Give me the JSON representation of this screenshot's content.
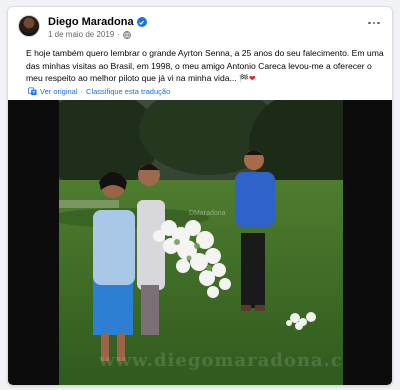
{
  "post": {
    "author": "Diego Maradona",
    "date": "1 de maio de 2019",
    "date_separator": "·",
    "text": "E hoje também quero lembrar o grande Ayrton Senna, a 25 anos do seu falecimento. Em uma das minhas visitas ao Brasil, em 1998, o meu amigo Antonio Careca levou-me a oferecer o meu respeito ao melhor piloto que já vi na minha vida...",
    "emoji_flag": "🏁",
    "emoji_heart": "❤",
    "see_original": "Ver original",
    "separator": "·",
    "rate_translation": "Classifique esta tradução"
  },
  "photo": {
    "watermark": "www.diegomaradona.com",
    "small_watermark": "DMaradona"
  },
  "colors": {
    "accent": "#1b74e4",
    "link": "#216fdb",
    "text": "#050505",
    "muted": "#65676b"
  },
  "icons": [
    "verified-badge-icon",
    "globe-icon",
    "more-options-icon",
    "translate-icon"
  ]
}
